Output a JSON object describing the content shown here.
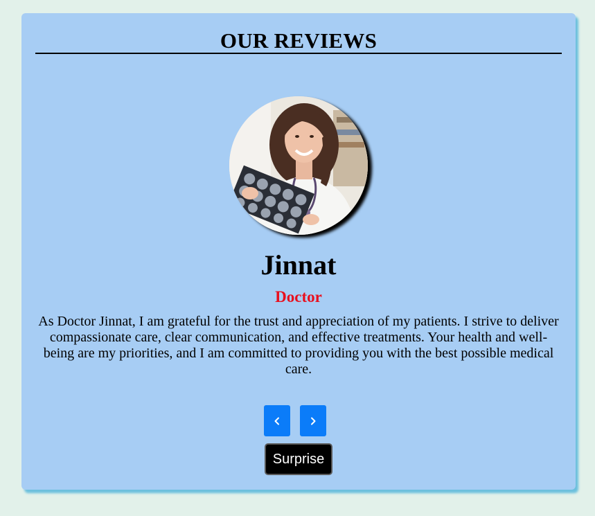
{
  "page": {
    "title": "OUR REVIEWS"
  },
  "review": {
    "name": "Jinnat",
    "role": "Doctor",
    "text": "As Doctor Jinnat, I am grateful for the trust and appreciation of my patients. I strive to deliver compassionate care, clear communication, and effective treatments. Your health and well-being are my priorities, and I am committed to providing you with the best possible medical care.",
    "photo": "doctor-holding-xray-photo"
  },
  "controls": {
    "prev_icon": "chevron-left-icon",
    "next_icon": "chevron-right-icon",
    "surprise_label": "Surprise"
  },
  "colors": {
    "background": "#e2f1ea",
    "card": "#a7cdf4",
    "card_shadow": "#6cc0dd",
    "role": "#e8101e",
    "nav_button": "#0b7cf9",
    "surprise_button": "#000000"
  }
}
